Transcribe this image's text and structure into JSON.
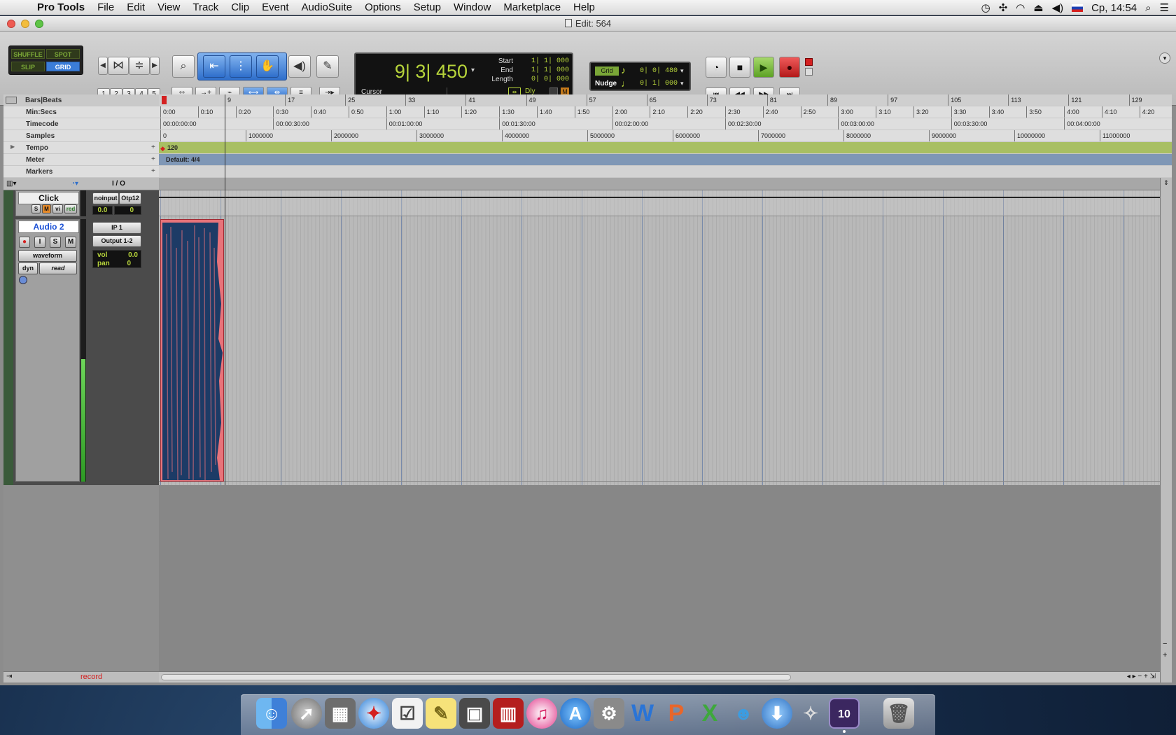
{
  "menubar": {
    "app_name": "Pro Tools",
    "items": [
      "File",
      "Edit",
      "View",
      "Track",
      "Clip",
      "Event",
      "AudioSuite",
      "Options",
      "Setup",
      "Window",
      "Marketplace",
      "Help"
    ],
    "clock": "Ср, 14:54"
  },
  "window": {
    "title": "Edit: 564"
  },
  "edit_modes": {
    "shuffle": "SHUFFLE",
    "spot": "SPOT",
    "slip": "SLIP",
    "grid": "GRID"
  },
  "zoom_presets": [
    "1",
    "2",
    "3",
    "4",
    "5"
  ],
  "counter": {
    "main": "9| 3| 450",
    "start_label": "Start",
    "start": "1| 1| 000",
    "end_label": "End",
    "end": "1| 1| 000",
    "length_label": "Length",
    "length": "0| 0| 000",
    "cursor_label": "Cursor",
    "dly_label": "Dly"
  },
  "grid_nudge": {
    "grid_label": "Grid",
    "grid_value": "0| 0| 480",
    "nudge_label": "Nudge",
    "nudge_value": "0| 1| 000"
  },
  "rulers": {
    "labels": [
      "Bars|Beats",
      "Min:Secs",
      "Timecode",
      "Samples",
      "Tempo",
      "Meter",
      "Markers"
    ],
    "bars": [
      "9",
      "17",
      "25",
      "33",
      "41",
      "49",
      "57",
      "65",
      "73",
      "81",
      "89",
      "97",
      "105",
      "113",
      "121",
      "129"
    ],
    "minsecs": [
      "0:00",
      "0:10",
      "0:20",
      "0:30",
      "0:40",
      "0:50",
      "1:00",
      "1:10",
      "1:20",
      "1:30",
      "1:40",
      "1:50",
      "2:00",
      "2:10",
      "2:20",
      "2:30",
      "2:40",
      "2:50",
      "3:00",
      "3:10",
      "3:20",
      "3:30",
      "3:40",
      "3:50",
      "4:00",
      "4:10",
      "4:20"
    ],
    "timecode": [
      "00:00:00:00",
      "00:00:30:00",
      "00:01:00:00",
      "00:01:30:00",
      "00:02:00:00",
      "00:02:30:00",
      "00:03:00:00",
      "00:03:30:00",
      "00:04:00:00"
    ],
    "samples": [
      "0",
      "1000000",
      "2000000",
      "3000000",
      "4000000",
      "5000000",
      "6000000",
      "7000000",
      "8000000",
      "9000000",
      "10000000",
      "11000000"
    ],
    "tempo_value": "120",
    "meter_value": "Default: 4/4"
  },
  "io_header": "I / O",
  "tracks": {
    "click": {
      "name": "Click",
      "s": "S",
      "m": "M",
      "vi": "vi",
      "red": "red",
      "input": "noinput",
      "output": "Otp12",
      "vol": "0.0",
      "pan": "0"
    },
    "audio2": {
      "name": "Audio 2",
      "i": "I",
      "s": "S",
      "m": "M",
      "view": "waveform",
      "dyn": "dyn",
      "auto": "read",
      "input": "IP 1",
      "output": "Output 1-2",
      "vol_label": "vol",
      "vol": "0.0",
      "pan_label": "pan",
      "pan": "0"
    }
  },
  "status": {
    "record": "record"
  },
  "colors": {
    "accent_green": "#b7d43b",
    "record_red": "#d42020",
    "clip_fill": "#1d3b66",
    "clip_bg": "#e8737a"
  },
  "dock_icons": [
    "finder-icon",
    "launchpad-icon",
    "calculator-icon",
    "safari-icon",
    "reminders-icon",
    "stickies-icon",
    "facetime-icon",
    "photo-booth-icon",
    "itunes-icon",
    "app-store-icon",
    "system-preferences-icon",
    "word-icon",
    "powerpoint-icon",
    "excel-icon",
    "messenger-icon",
    "downloads-icon",
    "directory-utility-icon",
    "pro-tools-icon",
    "trash-icon"
  ]
}
